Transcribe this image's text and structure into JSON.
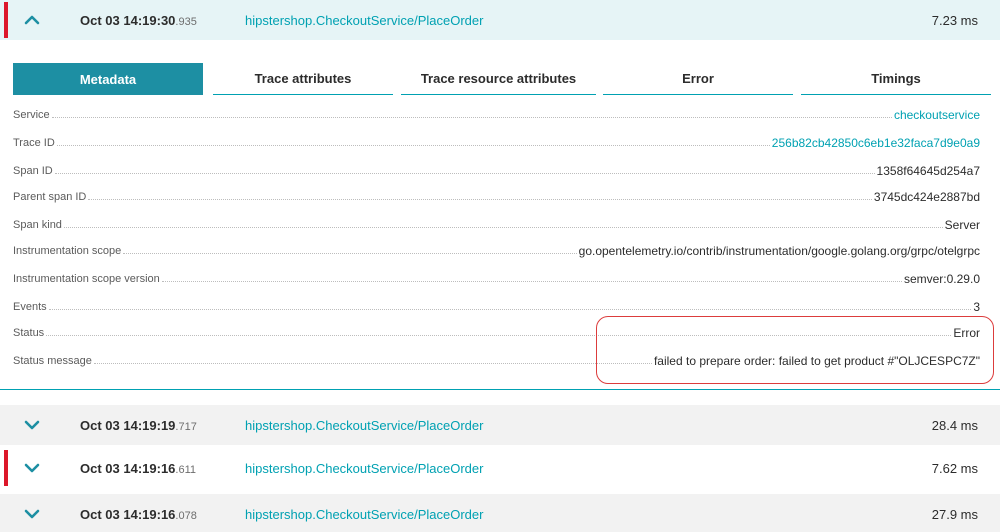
{
  "spans": [
    {
      "date": "Oct 03",
      "time": "14:19:30",
      "ms": ".935",
      "name": "hipstershop.CheckoutService/PlaceOrder",
      "duration": "7.23 ms",
      "expanded": true,
      "error": true
    },
    {
      "date": "Oct 03",
      "time": "14:19:19",
      "ms": ".717",
      "name": "hipstershop.CheckoutService/PlaceOrder",
      "duration": "28.4 ms",
      "expanded": false,
      "error": false
    },
    {
      "date": "Oct 03",
      "time": "14:19:16",
      "ms": ".611",
      "name": "hipstershop.CheckoutService/PlaceOrder",
      "duration": "7.62 ms",
      "expanded": false,
      "error": true
    },
    {
      "date": "Oct 03",
      "time": "14:19:16",
      "ms": ".078",
      "name": "hipstershop.CheckoutService/PlaceOrder",
      "duration": "27.9 ms",
      "expanded": false,
      "error": false
    }
  ],
  "tabs": [
    "Metadata",
    "Trace attributes",
    "Trace resource attributes",
    "Error",
    "Timings"
  ],
  "active_tab": "Metadata",
  "metadata": [
    {
      "key": "Service",
      "value": "checkoutservice",
      "link": true
    },
    {
      "key": "Trace ID",
      "value": "256b82cb42850c6eb1e32faca7d9e0a9",
      "link": true
    },
    {
      "key": "Span ID",
      "value": "1358f64645d254a7",
      "link": false
    },
    {
      "key": "Parent span ID",
      "value": "3745dc424e2887bd",
      "link": false
    },
    {
      "key": "Span kind",
      "value": "Server",
      "link": false
    },
    {
      "key": "Instrumentation scope",
      "value": "go.opentelemetry.io/contrib/instrumentation/google.golang.org/grpc/otelgrpc",
      "link": false
    },
    {
      "key": "Instrumentation scope version",
      "value": "semver:0.29.0",
      "link": false
    },
    {
      "key": "Events",
      "value": "3",
      "link": false
    },
    {
      "key": "Status",
      "value": "Error",
      "link": false
    },
    {
      "key": "Status message",
      "value": "failed to prepare order: failed to get product #\"OLJCESPC7Z\"",
      "link": false
    }
  ],
  "colors": {
    "accent": "#00a1b2",
    "error": "#dc172a",
    "tab_active": "#1d8fa3",
    "highlight": "#dc3c3c"
  }
}
